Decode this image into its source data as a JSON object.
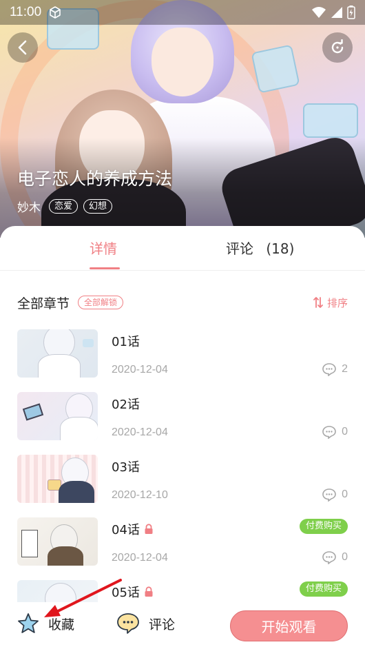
{
  "status_bar": {
    "time": "11:00"
  },
  "comic": {
    "title": "电子恋人的养成方法",
    "author": "妙木",
    "tags": [
      "恋爱",
      "幻想"
    ]
  },
  "tabs": {
    "details": "详情",
    "comments": "评论",
    "comment_count": "(18)"
  },
  "section": {
    "title": "全部章节",
    "unlock_all": "全部解锁",
    "sort": "排序"
  },
  "chapters": [
    {
      "name": "01话",
      "date": "2020-12-04",
      "comments": "2",
      "locked": false,
      "paid_label": ""
    },
    {
      "name": "02话",
      "date": "2020-12-04",
      "comments": "0",
      "locked": false,
      "paid_label": ""
    },
    {
      "name": "03话",
      "date": "2020-12-10",
      "comments": "0",
      "locked": false,
      "paid_label": ""
    },
    {
      "name": "04话",
      "date": "2020-12-04",
      "comments": "0",
      "locked": true,
      "paid_label": "付费购买"
    },
    {
      "name": "05话",
      "date": "",
      "comments": "",
      "locked": true,
      "paid_label": "付费购买"
    }
  ],
  "bottom_bar": {
    "favorite": "收藏",
    "comment": "评论",
    "start_watching": "开始观看"
  },
  "colors": {
    "accent": "#f07f84",
    "paid": "#7fcf4b",
    "watch_button": "#f58f91"
  }
}
